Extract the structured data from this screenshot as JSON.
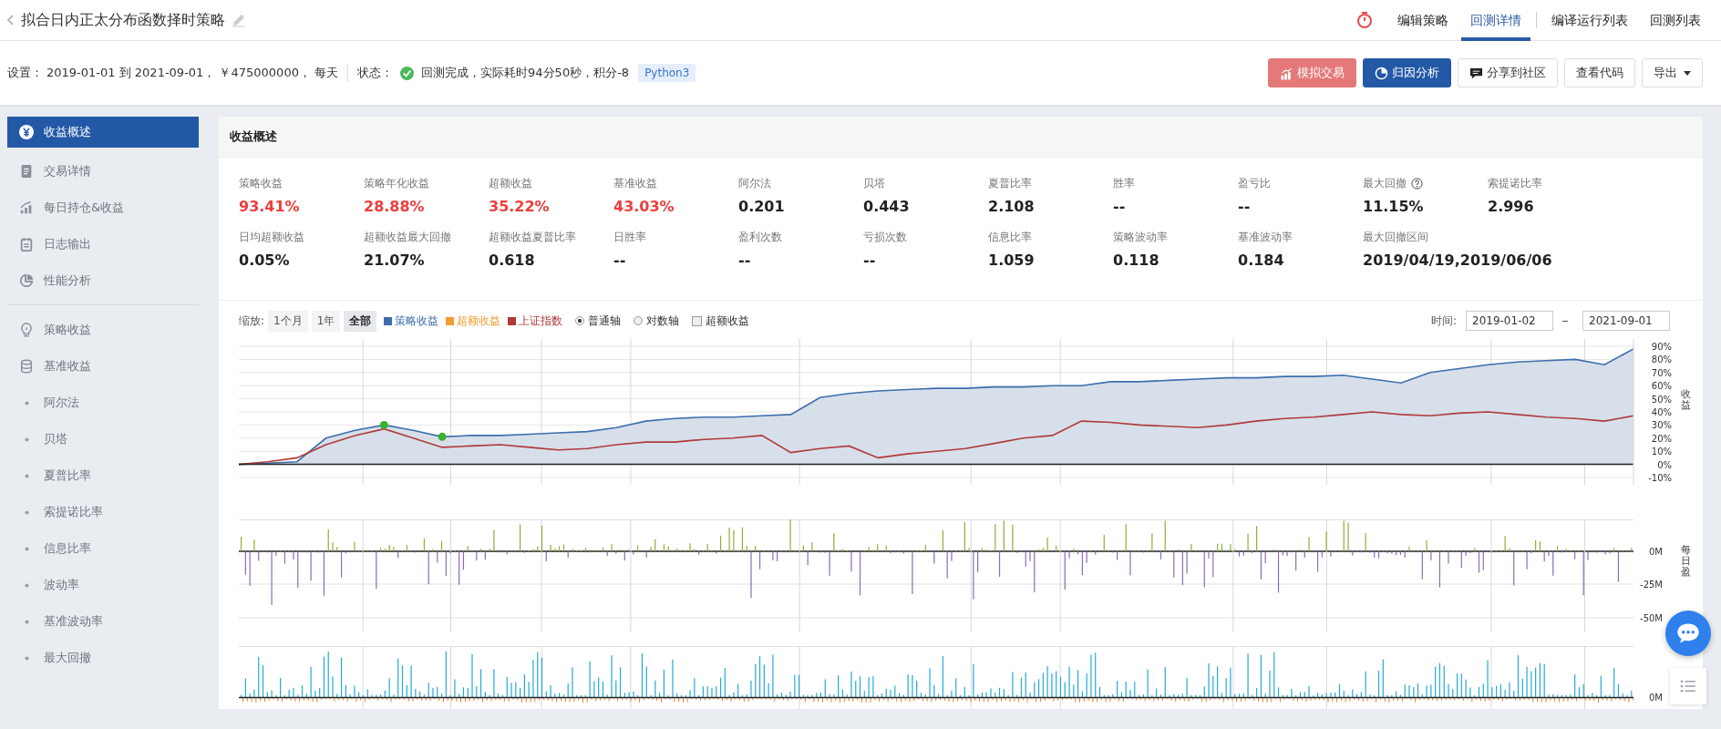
{
  "header": {
    "title": "拟合日内正太分布函数择时策略",
    "nav": [
      {
        "label": "编辑策略",
        "selected": false
      },
      {
        "label": "回测详情",
        "selected": true
      },
      {
        "label": "编译运行列表",
        "selected": false
      },
      {
        "label": "回测列表",
        "selected": false
      }
    ]
  },
  "settings": {
    "label": "设置：",
    "text": "2019-01-01 到 2021-09-01， ￥475000000， 每天",
    "status_label": "状态：",
    "status_text": "回测完成，实际耗时94分50秒，积分-8",
    "language_tag": "Python3"
  },
  "actions": [
    {
      "label": "模拟交易",
      "kind": "trend",
      "disabled": true
    },
    {
      "label": "归因分析",
      "kind": "primary",
      "disabled": false
    },
    {
      "label": "分享到社区",
      "kind": "share",
      "disabled": false
    },
    {
      "label": "查看代码",
      "kind": "plain",
      "disabled": false
    },
    {
      "label": "导出",
      "kind": "dropdown",
      "disabled": false
    }
  ],
  "sidebar": {
    "sections": [
      {
        "items": [
          {
            "label": "收益概述",
            "kind": "icon",
            "selected": true
          },
          {
            "label": "交易详情",
            "kind": "icon",
            "selected": false
          },
          {
            "label": "每日持仓&收益",
            "kind": "icon",
            "selected": false
          },
          {
            "label": "日志输出",
            "kind": "icon",
            "selected": false
          },
          {
            "label": "性能分析",
            "kind": "icon",
            "selected": false
          }
        ]
      },
      {
        "items": [
          {
            "label": "策略收益",
            "kind": "icon",
            "selected": false
          },
          {
            "label": "基准收益",
            "kind": "icon",
            "selected": false
          },
          {
            "label": "阿尔法",
            "kind": "bullet",
            "selected": false
          },
          {
            "label": "贝塔",
            "kind": "bullet",
            "selected": false
          },
          {
            "label": "夏普比率",
            "kind": "bullet",
            "selected": false
          },
          {
            "label": "索提诺比率",
            "kind": "bullet",
            "selected": false
          },
          {
            "label": "信息比率",
            "kind": "bullet",
            "selected": false
          },
          {
            "label": "波动率",
            "kind": "bullet",
            "selected": false
          },
          {
            "label": "基准波动率",
            "kind": "bullet",
            "selected": false
          },
          {
            "label": "最大回撤",
            "kind": "bullet",
            "selected": false
          }
        ]
      }
    ]
  },
  "overview": {
    "title": "收益概述",
    "metrics": [
      {
        "label": "策略收益",
        "value": "93.41%",
        "highlight": true,
        "help": false
      },
      {
        "label": "策略年化收益",
        "value": "28.88%",
        "highlight": true,
        "help": false
      },
      {
        "label": "超额收益",
        "value": "35.22%",
        "highlight": true,
        "help": false
      },
      {
        "label": "基准收益",
        "value": "43.03%",
        "highlight": true,
        "help": false
      },
      {
        "label": "阿尔法",
        "value": "0.201",
        "highlight": false,
        "help": false
      },
      {
        "label": "贝塔",
        "value": "0.443",
        "highlight": false,
        "help": false
      },
      {
        "label": "夏普比率",
        "value": "2.108",
        "highlight": false,
        "help": false
      },
      {
        "label": "胜率",
        "value": "--",
        "highlight": false,
        "help": false
      },
      {
        "label": "盈亏比",
        "value": "--",
        "highlight": false,
        "help": false
      },
      {
        "label": "最大回撤",
        "value": "11.15%",
        "highlight": false,
        "help": true
      },
      {
        "label": "索提诺比率",
        "value": "2.996",
        "highlight": false,
        "help": false
      },
      {
        "label": "日均超额收益",
        "value": "0.05%",
        "highlight": false,
        "help": false
      },
      {
        "label": "超额收益最大回撤",
        "value": "21.07%",
        "highlight": false,
        "help": false
      },
      {
        "label": "超额收益夏普比率",
        "value": "0.618",
        "highlight": false,
        "help": false
      },
      {
        "label": "日胜率",
        "value": "--",
        "highlight": false,
        "help": false
      },
      {
        "label": "盈利次数",
        "value": "--",
        "highlight": false,
        "help": false
      },
      {
        "label": "亏损次数",
        "value": "--",
        "highlight": false,
        "help": false
      },
      {
        "label": "信息比率",
        "value": "1.059",
        "highlight": false,
        "help": false
      },
      {
        "label": "策略波动率",
        "value": "0.118",
        "highlight": false,
        "help": false
      },
      {
        "label": "基准波动率",
        "value": "0.184",
        "highlight": false,
        "help": false
      },
      {
        "label": "最大回撤区间",
        "value": "2019/04/19,2019/06/06",
        "highlight": false,
        "help": false
      }
    ]
  },
  "chart_controls": {
    "zoom_label": "缩放:",
    "zoom_options": [
      {
        "label": "1个月",
        "selected": false
      },
      {
        "label": "1年",
        "selected": false
      },
      {
        "label": "全部",
        "selected": true
      }
    ],
    "excess_legend": {
      "label": "超额收益",
      "color": "#f39c32"
    },
    "axis_options": [
      {
        "label": "普通轴",
        "selected": true
      },
      {
        "label": "对数轴",
        "selected": false
      }
    ],
    "excess_toggle": {
      "label": "超额收益",
      "checked": false
    },
    "time_label": "时间:",
    "start": "2019-01-02",
    "end": "2021-09-01"
  },
  "returns_chart": {
    "chart_data": {
      "type": "line",
      "ylabel": "收益",
      "ylim": [
        -10,
        90
      ],
      "grid": true,
      "yticks": [
        {
          "value": 90,
          "label": "90%"
        },
        {
          "value": 80,
          "label": "80%"
        },
        {
          "value": 70,
          "label": "70%"
        },
        {
          "value": 60,
          "label": "60%"
        },
        {
          "value": 50,
          "label": "50%"
        },
        {
          "value": 40,
          "label": "40%"
        },
        {
          "value": 30,
          "label": "30%"
        },
        {
          "value": 20,
          "label": "20%"
        },
        {
          "value": 10,
          "label": "10%"
        },
        {
          "value": 0,
          "label": "0%"
        },
        {
          "value": -10,
          "label": "-10%"
        }
      ],
      "series": [
        {
          "name": "策略收益",
          "color": "#3d6eab",
          "values": [
            0,
            1,
            2,
            20,
            26,
            30,
            26,
            21,
            22,
            22,
            23,
            24,
            25,
            28,
            33,
            35,
            36,
            36,
            37,
            38,
            51,
            54,
            56,
            57,
            58,
            58,
            59,
            59,
            60,
            60,
            63,
            63,
            64,
            65,
            66,
            66,
            67,
            67,
            68,
            65,
            62,
            70,
            73,
            76,
            78,
            79,
            80,
            76,
            88
          ]
        },
        {
          "name": "上证指数",
          "color": "#b03a3a",
          "values": [
            0,
            2,
            5,
            15,
            22,
            27,
            20,
            13,
            14,
            15,
            13,
            11,
            12,
            15,
            17,
            17,
            19,
            20,
            22,
            9,
            12,
            14,
            5,
            8,
            10,
            12,
            16,
            20,
            22,
            33,
            32,
            30,
            29,
            28,
            30,
            33,
            35,
            36,
            38,
            40,
            38,
            37,
            39,
            40,
            38,
            36,
            35,
            33,
            37
          ]
        }
      ]
    }
  },
  "pnl_chart": {
    "y_ticks": [
      "0M",
      "-25M",
      "-50M"
    ],
    "axis_title": "每日盈"
  },
  "volume_chart": {
    "y_ticks": [
      "0M"
    ]
  }
}
